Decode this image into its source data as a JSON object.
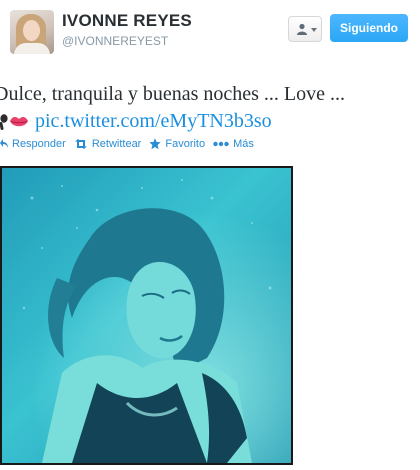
{
  "user": {
    "display_name": "IVONNE REYES",
    "screen_name": "@IVONNEREYEST"
  },
  "header_buttons": {
    "user_dropdown_icon": "person-icon",
    "follow_label": "Siguiendo"
  },
  "tweet": {
    "line1": "Dulce, tranquila y buenas noches ... Love ...",
    "emojis": [
      "microphone-icon",
      "kiss-lips-icon"
    ],
    "link": "pic.twitter.com/eMyTN3b3so"
  },
  "actions": {
    "reply": "Responder",
    "retweet": "Retwittear",
    "favorite": "Favorito",
    "more": "Más"
  },
  "colors": {
    "link": "#1a8fe0",
    "action": "#2a8dd4",
    "follow": "#2ba7f5",
    "photo_tint": "#35bfd1"
  }
}
